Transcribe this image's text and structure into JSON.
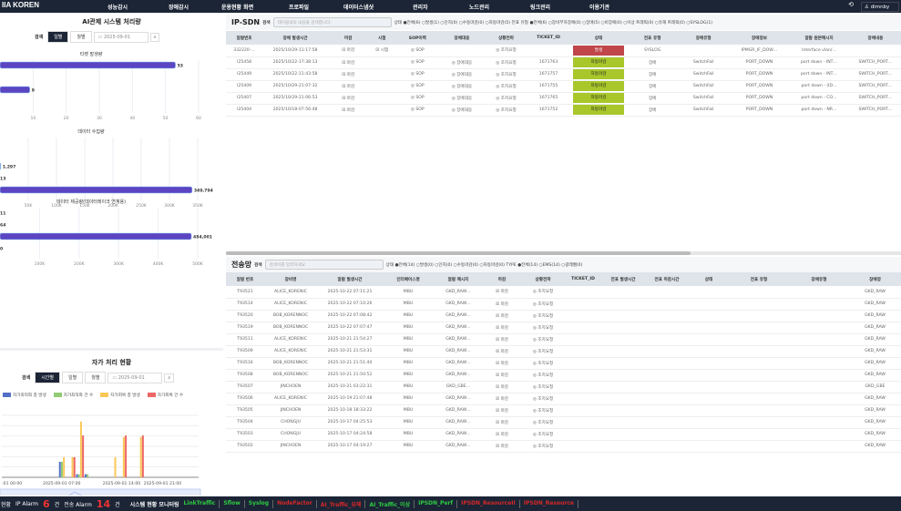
{
  "nav": {
    "logo": "IIA KOREN",
    "items": [
      "성능감시",
      "장애감시",
      "운용현황 화면",
      "프로파일",
      "데이터스냅샷",
      "관리자",
      "노드관리",
      "링크관리",
      "이용기관"
    ],
    "user": "dimnby"
  },
  "left": {
    "title": "AI관제 시스템 처리량",
    "search_label": "검색",
    "seg": [
      "일별",
      "월별"
    ],
    "date": "2025-09-01",
    "date2": "2025-09-01",
    "charts": [
      {
        "title": "티켓 발생량",
        "bars": [
          53,
          9
        ],
        "ticks": [
          "10",
          "20",
          "30",
          "40",
          "50",
          "60"
        ],
        "max": 60,
        "labels": [
          "53",
          "9"
        ]
      },
      {
        "title": "데이터 수집량",
        "bars": [
          0,
          0,
          1297,
          13,
          349794
        ],
        "ticks": [
          "50K",
          "100K",
          "150K",
          "200K",
          "250K",
          "300K",
          "350K"
        ],
        "max": 360000,
        "labels": [
          "",
          "",
          "1,297",
          "13",
          "349,794"
        ]
      },
      {
        "title": "데이터 제공량(데이터레이크 연계용)",
        "bars": [
          11,
          64,
          484001,
          0
        ],
        "ticks": [
          "100K",
          "200K",
          "300K",
          "400K",
          "500K"
        ],
        "max": 500000,
        "labels": [
          "11",
          "64",
          "484,001",
          "0"
        ]
      }
    ],
    "self": {
      "title": "자가 처리 현황",
      "seg": [
        "시간별",
        "일별",
        "월별"
      ],
      "date": "2025-09-01",
      "legend": [
        "자가최적화 총 발생",
        "자가최적화 건 수",
        "자가회복 총 발생",
        "자가회복 건 수"
      ],
      "colors": [
        "#5470c6",
        "#91cc75",
        "#fac858",
        "#ee6666"
      ],
      "xticks": [
        "-01 00:00",
        "2025-09-01 07:00",
        "2025-09-01 14:00",
        "2025-09-01 21:00"
      ]
    }
  },
  "chart_data": {
    "type": "bar",
    "title": "자가 처리 현황",
    "series": [
      {
        "name": "자가최적화 총 발생",
        "values": {
          "7": 1,
          "9": 0.2,
          "10": 0.2
        }
      },
      {
        "name": "자가최적화 건 수",
        "values": {
          "7": 1,
          "9": 0.2,
          "10": 0.2
        }
      },
      {
        "name": "자가회복 총 발생",
        "values": {
          "7": 1.3,
          "8": 1.3,
          "9": 3.6,
          "13": 1.3,
          "14": 2.6,
          "16": 2.6
        }
      },
      {
        "name": "자가회복 건 수",
        "values": {
          "8": 1.3,
          "9": 2.7,
          "14": 2.7,
          "16": 2.7
        }
      }
    ],
    "xlabel": "시간",
    "ylim": [
      0,
      4
    ]
  },
  "ipsdn": {
    "title": "IP-SDN",
    "search_label": "검색",
    "placeholder": "테이블내의 내용을 검색합니다.",
    "filters": "상태 ●전체(6) ○발생(1) ○인지(0) ○수동마감(0) ○자동마감(5) 전표 유형 ●전체(6) ○장비부하장애(0) ○장애(5) ○비장애(0) ○이상 트래픽(0) ○유해 트래픽(0) ○SYSLOG(1)",
    "columns": [
      "알람번호",
      "장애 발생시간",
      "마감",
      "시험",
      "SOP이력",
      "장애대응",
      "상황전파",
      "TICKET_ID",
      "상태",
      "전표 유형",
      "장애유형",
      "장애정보",
      "알람 원본메시지",
      "장애내용"
    ],
    "rows": [
      [
        "332220-…",
        "2025/10/29-11:17:58",
        "☒ 마감",
        "☒ 시험",
        "◎ SOP",
        "",
        "◎ 조치요청",
        "",
        "발생",
        "SYSLOG",
        "",
        "IPMGR_IF_DOW…",
        "Interface vlan/…",
        ""
      ],
      [
        "I25458",
        "2025/10/22-17:38:13",
        "☒ 마감",
        "",
        "◎ SOP",
        "◎ 장애대응",
        "◎ 조치요청",
        "1671763",
        "자동마감",
        "장애",
        "SwitchFail",
        "PORT_DOWN",
        "port down - INT…",
        "SWITCH_PORT…"
      ],
      [
        "I25449",
        "2025/10/22-11:43:58",
        "☒ 마감",
        "",
        "◎ SOP",
        "◎ 장애대응",
        "◎ 조치요청",
        "1671757",
        "자동마감",
        "장애",
        "SwitchFail",
        "PORT_DOWN",
        "port down - INT…",
        "SWITCH_PORT…"
      ],
      [
        "I25409",
        "2025/10/29-21:07:32",
        "☒ 마감",
        "",
        "◎ SOP",
        "◎ 장애대응",
        "◎ 조치요청",
        "1671755",
        "자동마감",
        "장애",
        "SwitchFail",
        "PORT_DOWN",
        "port down - (ID…",
        "SWITCH_PORT…"
      ],
      [
        "I25407",
        "2025/10/29-21:06:53",
        "☒ 마감",
        "",
        "◎ SOP",
        "◎ 장애대응",
        "◎ 조치요청",
        "1671765",
        "자동마감",
        "장애",
        "SwitchFail",
        "PORT_DOWN",
        "port down - CO…",
        "SWITCH_PORT…"
      ],
      [
        "I25404",
        "2025/10/18-07:56:48",
        "☒ 마감",
        "",
        "◎ SOP",
        "◎ 장애대응",
        "◎ 조치요청",
        "1671752",
        "자동마감",
        "장애",
        "SwitchFail",
        "PORT_DOWN",
        "port down - NR…",
        "SWITCH_PORT…"
      ]
    ]
  },
  "trans": {
    "title": "전송망",
    "search_label": "검색",
    "placeholder": "검색어를 입력하세요",
    "filters": "상태 ●전체(14) ○발생(0) ○인지(0) ○수동마감(0) ○자동마감(0)  TYPE ●전체(14) ○EMS(14) ○광레벨(0)",
    "columns": [
      "알람 번호",
      "장비명",
      "알람 발생시간",
      "인터페이스명",
      "알람 메시지",
      "마감",
      "상황전파",
      "TICKET_ID",
      "전표 발생시간",
      "전표 마감시간",
      "상태",
      "전표 유형",
      "장애유형",
      "장애정"
    ],
    "rows": [
      [
        "T93521",
        "ALICE_KORENIC",
        "2025-10-22 07:11:21",
        "MBU",
        "GKD_RAW…",
        "☒ 마감",
        "◎ 조치요청",
        "",
        "",
        "",
        "",
        "",
        "",
        "GKD_RAW"
      ],
      [
        "T93514",
        "ALICE_KORENIC",
        "2025-10-22 07:10:26",
        "MBU",
        "GKD_RAW…",
        "☒ 마감",
        "◎ 조치요청",
        "",
        "",
        "",
        "",
        "",
        "",
        "GKD_RAW"
      ],
      [
        "T93520",
        "BOB_KORENNOC",
        "2025-10-22 07:08:42",
        "MBU",
        "GKD_RAW…",
        "☒ 마감",
        "◎ 조치요청",
        "",
        "",
        "",
        "",
        "",
        "",
        "GKD_RAW"
      ],
      [
        "T93519",
        "BOB_KORENNOC",
        "2025-10-22 07:07:47",
        "MBU",
        "GKD_RAW…",
        "☒ 마감",
        "◎ 조치요청",
        "",
        "",
        "",
        "",
        "",
        "",
        "GKD_RAW"
      ],
      [
        "T93511",
        "ALICE_KORENIC",
        "2025-10-21 21:54:27",
        "MBU",
        "GKD_RAW…",
        "☒ 마감",
        "◎ 조치요청",
        "",
        "",
        "",
        "",
        "",
        "",
        "GKD_RAW"
      ],
      [
        "T93509",
        "ALICE_KORENIC",
        "2025-10-21 21:53:31",
        "MBU",
        "GKD_RAW…",
        "☒ 마감",
        "◎ 조치요청",
        "",
        "",
        "",
        "",
        "",
        "",
        "GKD_RAW"
      ],
      [
        "T93516",
        "BOB_KORENNOC",
        "2025-10-21 21:51:40",
        "MBU",
        "GKD_RAW…",
        "☒ 마감",
        "◎ 조치요청",
        "",
        "",
        "",
        "",
        "",
        "",
        "GKD_RAW"
      ],
      [
        "T93508",
        "BOB_KORENNOC",
        "2025-10-21 21:50:52",
        "MBU",
        "GKD_RAW…",
        "☒ 마감",
        "◎ 조치요청",
        "",
        "",
        "",
        "",
        "",
        "",
        "GKD_RAW"
      ],
      [
        "T93507",
        "JINCHOEN",
        "2025-10-21 03:22:31",
        "MBU",
        "GKD_GBE…",
        "☒ 마감",
        "◎ 조치요청",
        "",
        "",
        "",
        "",
        "",
        "",
        "GKD_GBE"
      ],
      [
        "T93506",
        "ALICE_KORENIC",
        "2025-10-19 21:07:48",
        "MBU",
        "GKD_RAW…",
        "☒ 마감",
        "◎ 조치요청",
        "",
        "",
        "",
        "",
        "",
        "",
        "GKD_RAW"
      ],
      [
        "T93505",
        "JINCHOEN",
        "2025-10-18 18:33:22",
        "MBU",
        "GKD_RAW…",
        "☒ 마감",
        "◎ 조치요청",
        "",
        "",
        "",
        "",
        "",
        "",
        "GKD_RAW"
      ],
      [
        "T93504",
        "CHONGJU",
        "2025-10-17 04:25:53",
        "MBU",
        "GKD_RAW…",
        "☒ 마감",
        "◎ 조치요청",
        "",
        "",
        "",
        "",
        "",
        "",
        "GKD_RAW"
      ],
      [
        "T93503",
        "CHONGJU",
        "2025-10-17 04:24:58",
        "MBU",
        "GKD_RAW…",
        "☒ 마감",
        "◎ 조치요청",
        "",
        "",
        "",
        "",
        "",
        "",
        "GKD_RAW"
      ],
      [
        "T93502",
        "JINCHOEN",
        "2025-10-17 04:19:27",
        "MBU",
        "GKD_RAW…",
        "☒ 마감",
        "◎ 조치요청",
        "",
        "",
        "",
        "",
        "",
        "",
        "GKD_RAW"
      ]
    ]
  },
  "status": {
    "prefix": "현황",
    "ip_label": "IP Alarm",
    "ip_count": "6",
    "unit": "건",
    "tr_label": "전송 Alarm",
    "tr_count": "14",
    "unit2": "건",
    "mon": "시스템 현황 모니터링",
    "links": [
      {
        "t": "LinkTraffic",
        "c": "#2ecc40"
      },
      {
        "t": "Sflow",
        "c": "#2ecc40"
      },
      {
        "t": "Syslog",
        "c": "#2ecc40"
      },
      {
        "t": "NodeFactor",
        "c": "#d62828"
      },
      {
        "t": "AI_Traffic_유해",
        "c": "#d62828"
      },
      {
        "t": "AI_Traffic_이상",
        "c": "#2ecc40"
      },
      {
        "t": "IPSDN_Perf",
        "c": "#2ecc40"
      },
      {
        "t": "IPSDN_ResourceII",
        "c": "#d62828"
      },
      {
        "t": "IPSDN_Resource",
        "c": "#d62828"
      }
    ]
  }
}
